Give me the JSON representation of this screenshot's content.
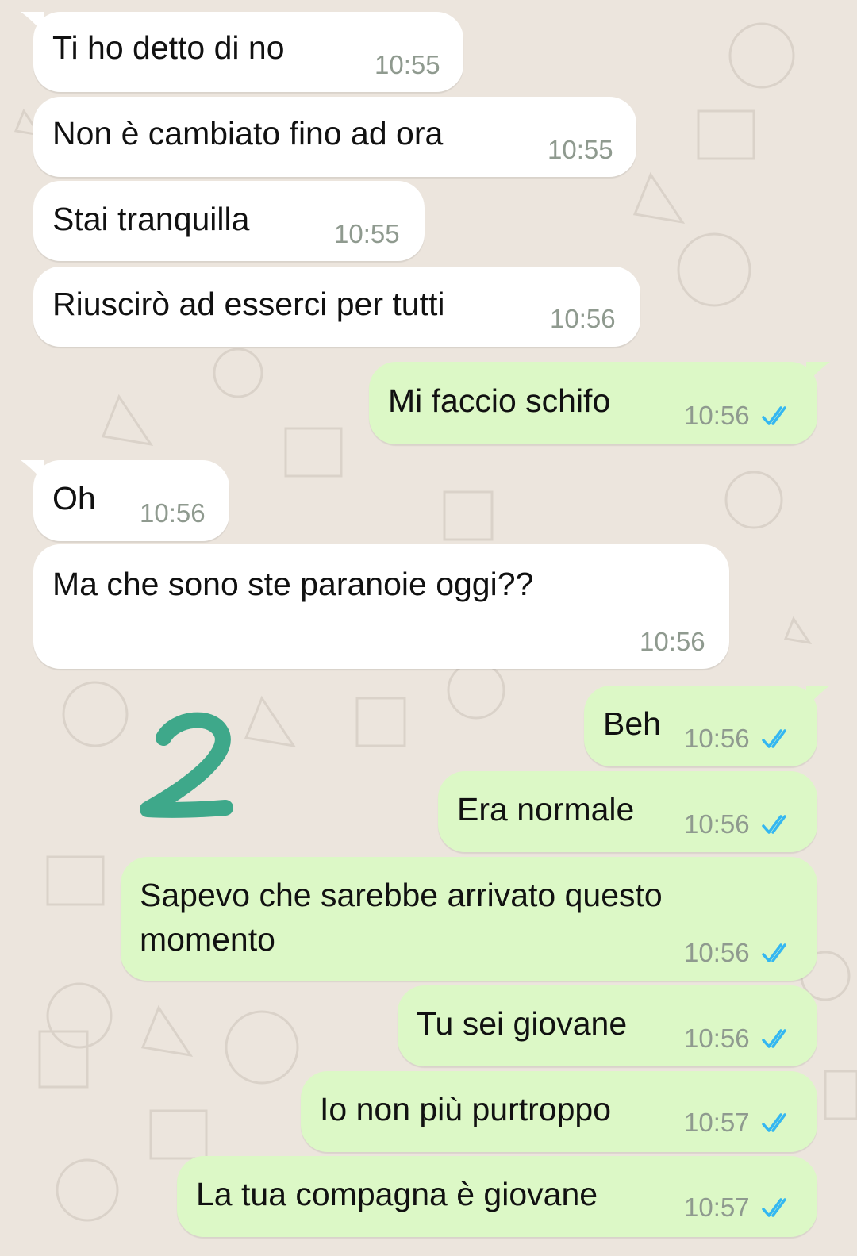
{
  "messages": [
    {
      "id": "m1",
      "dir": "in",
      "text": "Ti ho detto di no",
      "time": "10:55"
    },
    {
      "id": "m2",
      "dir": "in",
      "text": "Non è cambiato fino ad ora",
      "time": "10:55"
    },
    {
      "id": "m3",
      "dir": "in",
      "text": "Stai tranquilla",
      "time": "10:55"
    },
    {
      "id": "m4",
      "dir": "in",
      "text": "Riuscirò ad esserci per tutti",
      "time": "10:56"
    },
    {
      "id": "m5",
      "dir": "out",
      "text": "Mi faccio schifo",
      "time": "10:56",
      "status": "read"
    },
    {
      "id": "m6",
      "dir": "in",
      "text": "Oh",
      "time": "10:56"
    },
    {
      "id": "m7",
      "dir": "in",
      "text": "Ma che sono ste paranoie oggi??",
      "time": "10:56"
    },
    {
      "id": "m8",
      "dir": "out",
      "text": "Beh",
      "time": "10:56",
      "status": "read"
    },
    {
      "id": "m9",
      "dir": "out",
      "text": "Era normale",
      "time": "10:56",
      "status": "read"
    },
    {
      "id": "m10",
      "dir": "out",
      "text": "Sapevo che sarebbe arrivato questo\nmomento",
      "time": "10:56",
      "status": "read"
    },
    {
      "id": "m11",
      "dir": "out",
      "text": "Tu sei giovane",
      "time": "10:56",
      "status": "read"
    },
    {
      "id": "m12",
      "dir": "out",
      "text": "Io non più purtroppo",
      "time": "10:57",
      "status": "read"
    },
    {
      "id": "m13",
      "dir": "out",
      "text": "La tua compagna è giovane",
      "time": "10:57",
      "status": "read"
    }
  ],
  "annotation": {
    "text": "2",
    "color": "#3ea88a"
  },
  "colors": {
    "incoming": "#ffffff",
    "outgoing": "#dcf8c6",
    "read_ticks": "#34b7f1",
    "background": "#ece5dd"
  }
}
